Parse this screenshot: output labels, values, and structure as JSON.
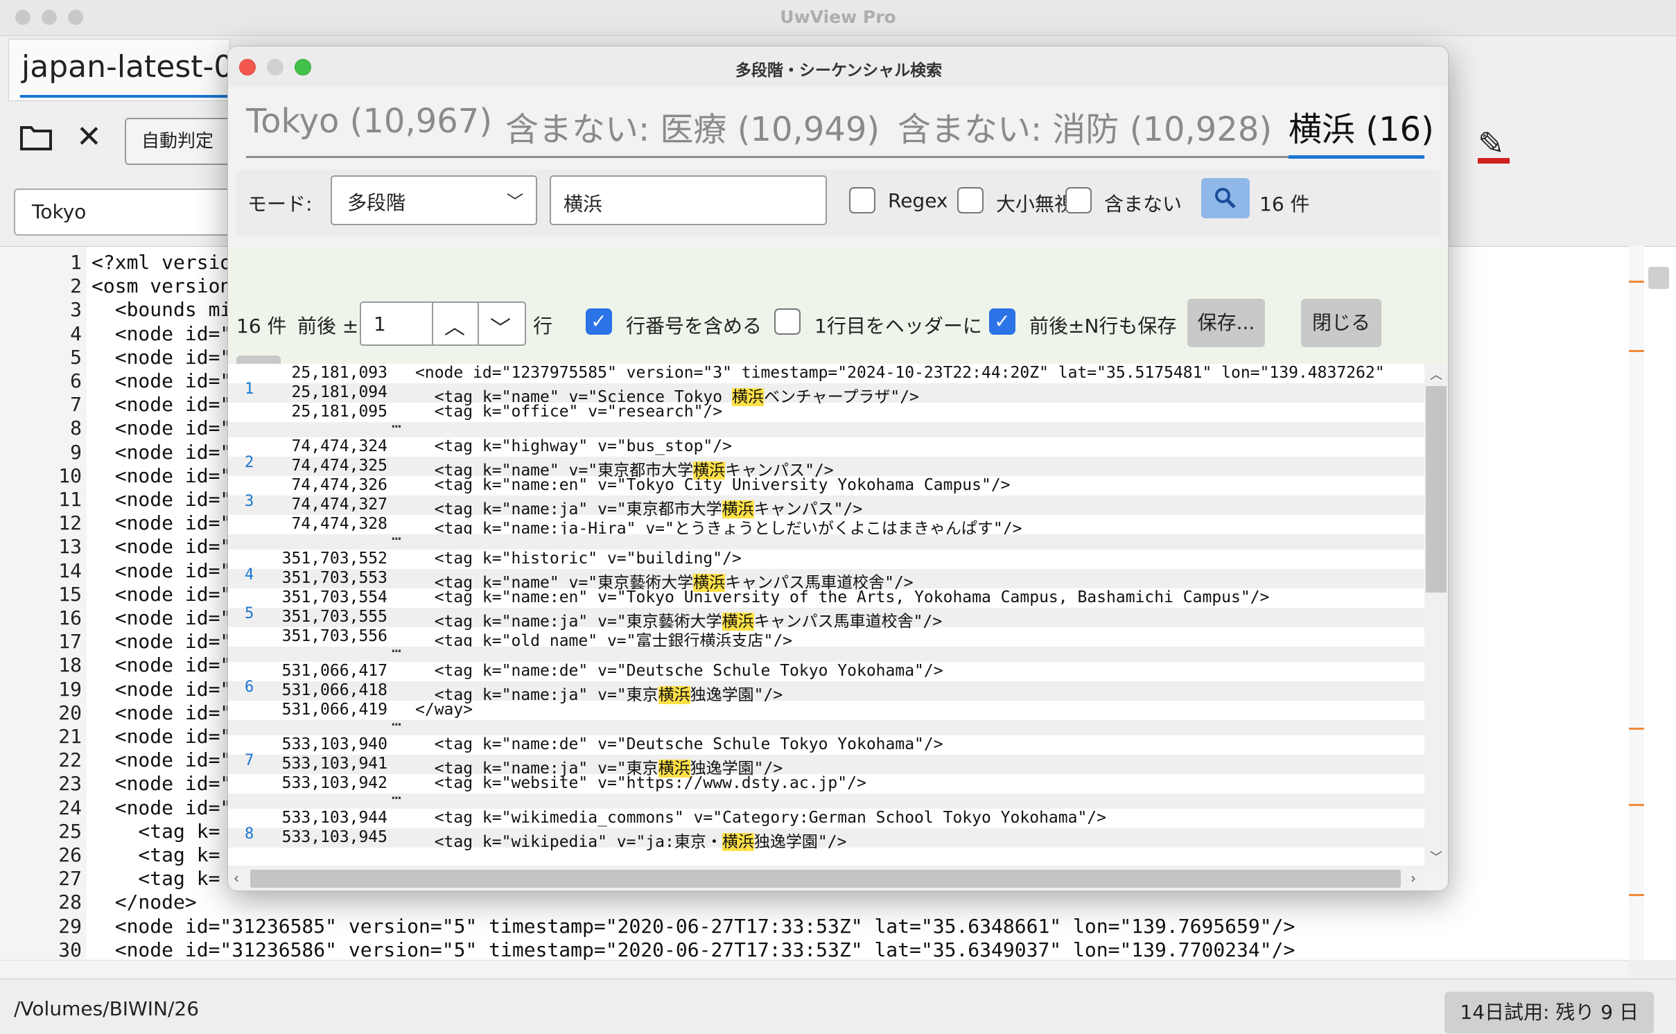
{
  "app": {
    "title": "UwView Pro",
    "file_tab": "japan-latest-0"
  },
  "main": {
    "auto_button": "自動判定",
    "search_value": "Tokyo",
    "status_path": "/Volumes/BIWIN/26",
    "trial": "14日試用: 残り 9 日",
    "lines": [
      {
        "n": "1",
        "code": "<?xml versio"
      },
      {
        "n": "2",
        "code": "<osm version"
      },
      {
        "n": "3",
        "code": "  <bounds mi"
      },
      {
        "n": "4",
        "code": "  <node id=\""
      },
      {
        "n": "5",
        "code": "  <node id=\""
      },
      {
        "n": "6",
        "code": "  <node id=\""
      },
      {
        "n": "7",
        "code": "  <node id=\""
      },
      {
        "n": "8",
        "code": "  <node id=\""
      },
      {
        "n": "9",
        "code": "  <node id=\""
      },
      {
        "n": "10",
        "code": "  <node id=\""
      },
      {
        "n": "11",
        "code": "  <node id=\""
      },
      {
        "n": "12",
        "code": "  <node id=\""
      },
      {
        "n": "13",
        "code": "  <node id=\""
      },
      {
        "n": "14",
        "code": "  <node id=\""
      },
      {
        "n": "15",
        "code": "  <node id=\""
      },
      {
        "n": "16",
        "code": "  <node id=\""
      },
      {
        "n": "17",
        "code": "  <node id=\""
      },
      {
        "n": "18",
        "code": "  <node id=\""
      },
      {
        "n": "19",
        "code": "  <node id=\""
      },
      {
        "n": "20",
        "code": "  <node id=\""
      },
      {
        "n": "21",
        "code": "  <node id=\""
      },
      {
        "n": "22",
        "code": "  <node id=\""
      },
      {
        "n": "23",
        "code": "  <node id=\""
      },
      {
        "n": "24",
        "code": "  <node id=\""
      },
      {
        "n": "25",
        "code": "    <tag k="
      },
      {
        "n": "26",
        "code": "    <tag k="
      },
      {
        "n": "27",
        "code": "    <tag k="
      },
      {
        "n": "28",
        "code": "  </node>"
      },
      {
        "n": "29",
        "code": "  <node id=\"31236585\" version=\"5\" timestamp=\"2020-06-27T17:33:53Z\" lat=\"35.6348661\" lon=\"139.7695659\"/>"
      },
      {
        "n": "30",
        "code": "  <node id=\"31236586\" version=\"5\" timestamp=\"2020-06-27T17:33:53Z\" lat=\"35.6349037\" lon=\"139.7700234\"/>"
      }
    ]
  },
  "dialog": {
    "title": "多段階・シーケンシャル検索",
    "stages": [
      "Tokyo (10,967)",
      "含まない: 医療 (10,949)",
      "含まない: 消防 (10,928)",
      "横浜 (16)"
    ],
    "mode_label": "モード:",
    "mode_value": "多段階",
    "query": "横浜",
    "regex_label": "Regex",
    "ignore_case_label": "大小無視",
    "exclude_label": "含まない",
    "hit_count": "16 件",
    "count2": "16 件",
    "context_label": "前後 ±",
    "context_value": "1",
    "row_unit": "行",
    "include_line_no_label": "行番号を含める",
    "header_first_label": "1行目をヘッダーに",
    "save_context_label": "前後±N行も保存",
    "save_button": "保存...",
    "close_button": "閉じる",
    "results": [
      {
        "hit": "",
        "num": "25,181,093",
        "pre": "<node id=\"1237975585\" version=\"3\" timestamp=\"2024-10-23T22:44:20Z\" lat=\"35.5175481\" lon=\"139.4837262\"",
        "hl": "",
        "post": ""
      },
      {
        "hit": "1",
        "num": "25,181,094",
        "pre": "  <tag k=\"name\" v=\"Science Tokyo ",
        "hl": "横浜",
        "post": "ベンチャープラザ\"/>"
      },
      {
        "hit": "",
        "num": "25,181,095",
        "pre": "  <tag k=\"office\" v=\"research\"/>",
        "hl": "",
        "post": ""
      },
      {
        "dots": "…"
      },
      {
        "hit": "",
        "num": "74,474,324",
        "pre": "  <tag k=\"highway\" v=\"bus_stop\"/>",
        "hl": "",
        "post": ""
      },
      {
        "hit": "2",
        "num": "74,474,325",
        "pre": "  <tag k=\"name\" v=\"東京都市大学",
        "hl": "横浜",
        "post": "キャンパス\"/>"
      },
      {
        "hit": "",
        "num": "74,474,326",
        "pre": "  <tag k=\"name:en\" v=\"Tokyo City University Yokohama Campus\"/>",
        "hl": "",
        "post": ""
      },
      {
        "hit": "3",
        "num": "74,474,327",
        "pre": "  <tag k=\"name:ja\" v=\"東京都市大学",
        "hl": "横浜",
        "post": "キャンパス\"/>"
      },
      {
        "hit": "",
        "num": "74,474,328",
        "pre": "  <tag k=\"name:ja-Hira\" v=\"とうきょうとしだいがくよこはまきゃんぱす\"/>",
        "hl": "",
        "post": ""
      },
      {
        "dots": "…"
      },
      {
        "hit": "",
        "num": "351,703,552",
        "pre": "  <tag k=\"historic\" v=\"building\"/>",
        "hl": "",
        "post": ""
      },
      {
        "hit": "4",
        "num": "351,703,553",
        "pre": "  <tag k=\"name\" v=\"東京藝術大学",
        "hl": "横浜",
        "post": "キャンパス馬車道校舎\"/>"
      },
      {
        "hit": "",
        "num": "351,703,554",
        "pre": "  <tag k=\"name:en\" v=\"Tokyo University of the Arts, Yokohama Campus, Bashamichi Campus\"/>",
        "hl": "",
        "post": ""
      },
      {
        "hit": "5",
        "num": "351,703,555",
        "pre": "  <tag k=\"name:ja\" v=\"東京藝術大学",
        "hl": "横浜",
        "post": "キャンパス馬車道校舎\"/>"
      },
      {
        "hit": "",
        "num": "351,703,556",
        "pre": "  <tag k=\"old_name\" v=\"富士銀行横浜支店\"/>",
        "hl": "",
        "post": ""
      },
      {
        "dots": "…"
      },
      {
        "hit": "",
        "num": "531,066,417",
        "pre": "  <tag k=\"name:de\" v=\"Deutsche Schule Tokyo Yokohama\"/>",
        "hl": "",
        "post": ""
      },
      {
        "hit": "6",
        "num": "531,066,418",
        "pre": "  <tag k=\"name:ja\" v=\"東京",
        "hl": "横浜",
        "post": "独逸学園\"/>"
      },
      {
        "hit": "",
        "num": "531,066,419",
        "pre": "</way>",
        "hl": "",
        "post": ""
      },
      {
        "dots": "…"
      },
      {
        "hit": "",
        "num": "533,103,940",
        "pre": "  <tag k=\"name:de\" v=\"Deutsche Schule Tokyo Yokohama\"/>",
        "hl": "",
        "post": ""
      },
      {
        "hit": "7",
        "num": "533,103,941",
        "pre": "  <tag k=\"name:ja\" v=\"東京",
        "hl": "横浜",
        "post": "独逸学園\"/>"
      },
      {
        "hit": "",
        "num": "533,103,942",
        "pre": "  <tag k=\"website\" v=\"https://www.dsty.ac.jp\"/>",
        "hl": "",
        "post": ""
      },
      {
        "dots": "…"
      },
      {
        "hit": "",
        "num": "533,103,944",
        "pre": "  <tag k=\"wikimedia_commons\" v=\"Category:German School Tokyo Yokohama\"/>",
        "hl": "",
        "post": ""
      },
      {
        "hit": "8",
        "num": "533,103,945",
        "pre": "  <tag k=\"wikipedia\" v=\"ja:東京・",
        "hl": "横浜",
        "post": "独逸学園\"/>"
      }
    ]
  },
  "colors": {
    "accent": "#1976d2",
    "highlight": "#fde047",
    "checkbox": "#2b73e6"
  }
}
